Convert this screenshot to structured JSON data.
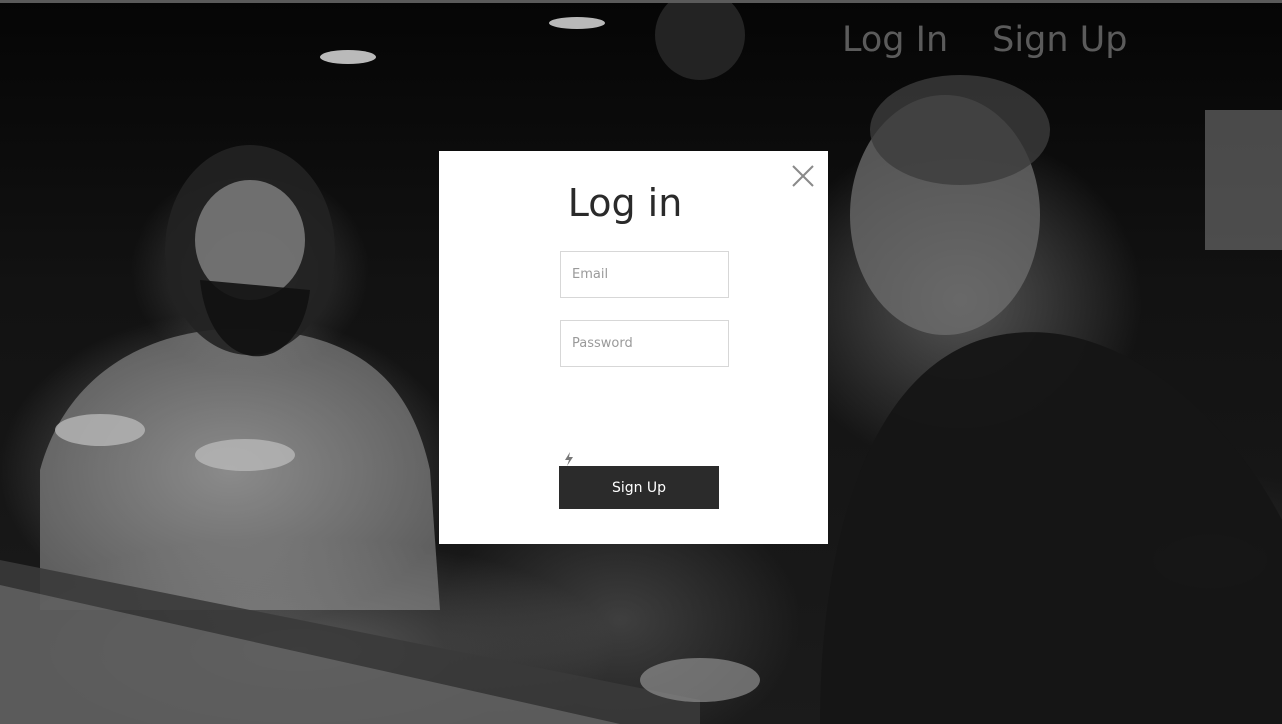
{
  "header": {
    "nav": [
      {
        "label": "Log In"
      },
      {
        "label": "Sign Up"
      }
    ]
  },
  "modal": {
    "title": "Log in",
    "email_placeholder": "Email",
    "password_placeholder": "Password",
    "submit_label": "Sign Up",
    "close_icon": "close-icon",
    "bolt_icon": "lightning-icon"
  },
  "colors": {
    "modal_bg": "#ffffff",
    "button_bg": "#2b2b2b",
    "button_text": "#ffffff",
    "nav_text": "#7a7a7a"
  }
}
